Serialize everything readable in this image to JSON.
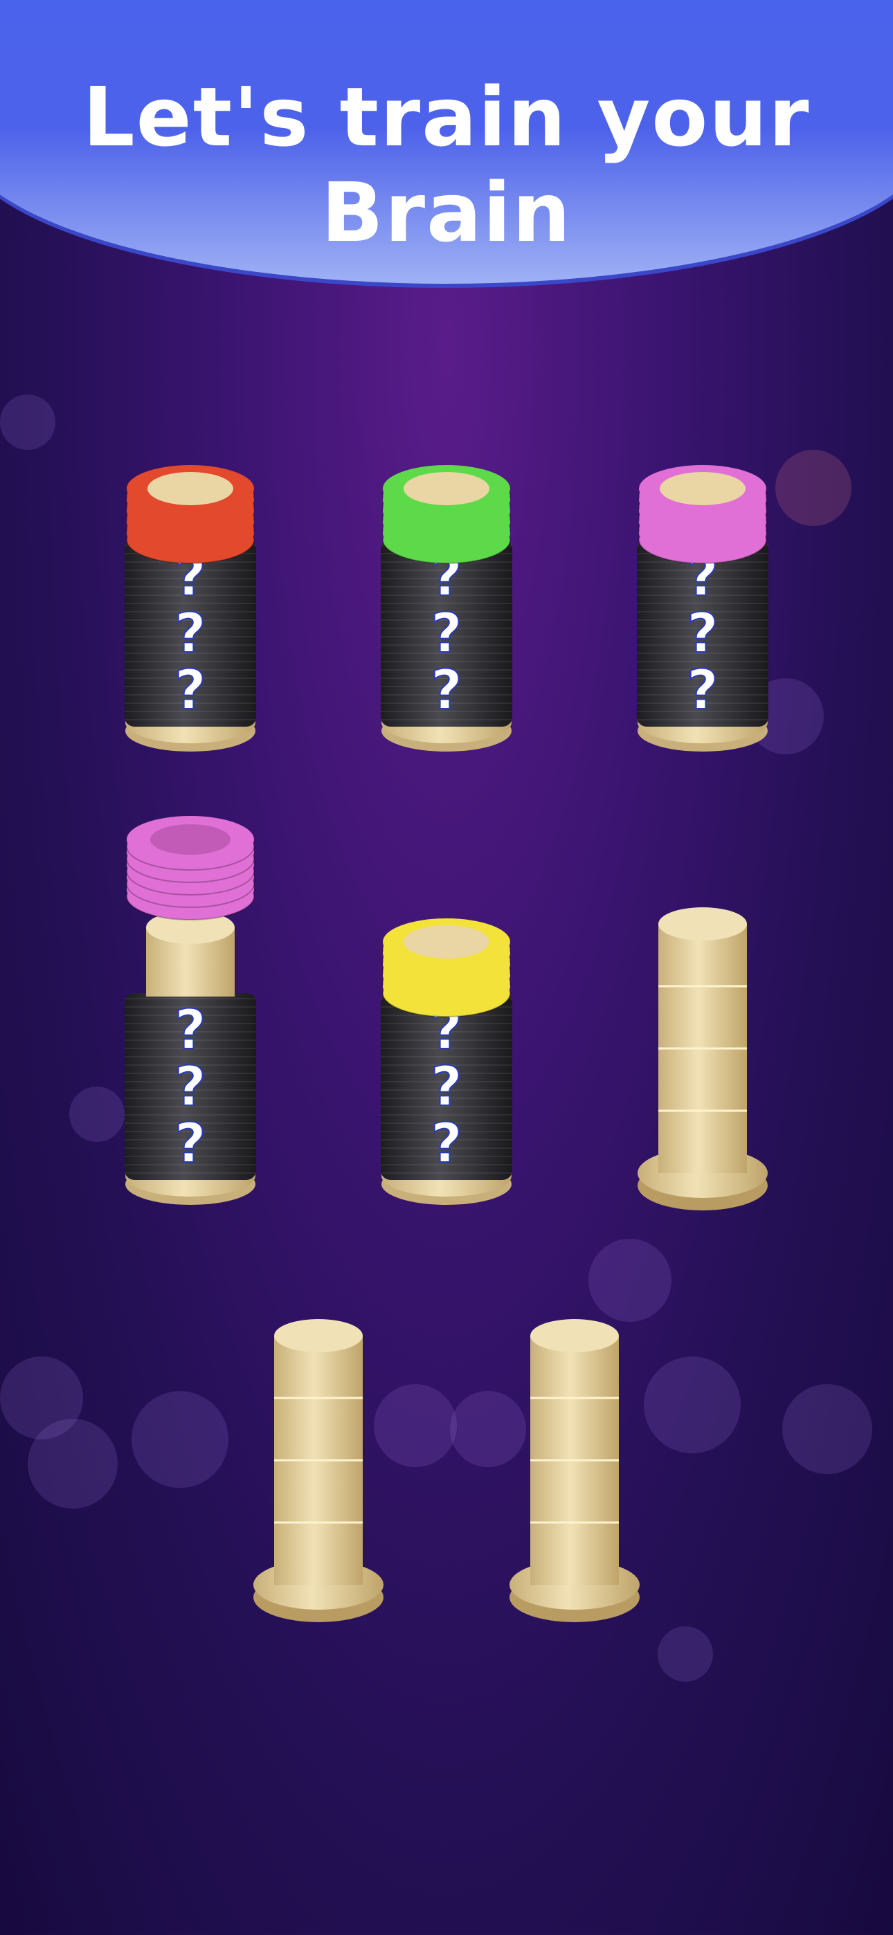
{
  "header": {
    "title": "Let's train your Brain"
  },
  "game": {
    "hidden_marker": "?",
    "colors": {
      "red": "#e3492c",
      "green": "#5ed94a",
      "pink": "#e06fd6",
      "yellow": "#f2e23a",
      "wood": "#e6d3a0",
      "hidden": "#2f2f33"
    },
    "pegs": [
      {
        "name": "peg-1",
        "top_color": "red",
        "top_count": 5,
        "hidden_count": 3,
        "empty": false
      },
      {
        "name": "peg-2",
        "top_color": "green",
        "top_count": 5,
        "hidden_count": 3,
        "empty": false
      },
      {
        "name": "peg-3",
        "top_color": "pink",
        "top_count": 5,
        "hidden_count": 3,
        "empty": false
      },
      {
        "name": "peg-4",
        "top_color": null,
        "top_count": 0,
        "hidden_count": 3,
        "empty": false,
        "lifted_color": "pink",
        "lifted_count": 5
      },
      {
        "name": "peg-5",
        "top_color": "yellow",
        "top_count": 5,
        "hidden_count": 3,
        "empty": false
      },
      {
        "name": "peg-6",
        "top_color": null,
        "top_count": 0,
        "hidden_count": 0,
        "empty": true
      },
      {
        "name": "peg-7",
        "top_color": null,
        "top_count": 0,
        "hidden_count": 0,
        "empty": true
      },
      {
        "name": "peg-8",
        "top_color": null,
        "top_count": 0,
        "hidden_count": 0,
        "empty": true
      }
    ]
  }
}
